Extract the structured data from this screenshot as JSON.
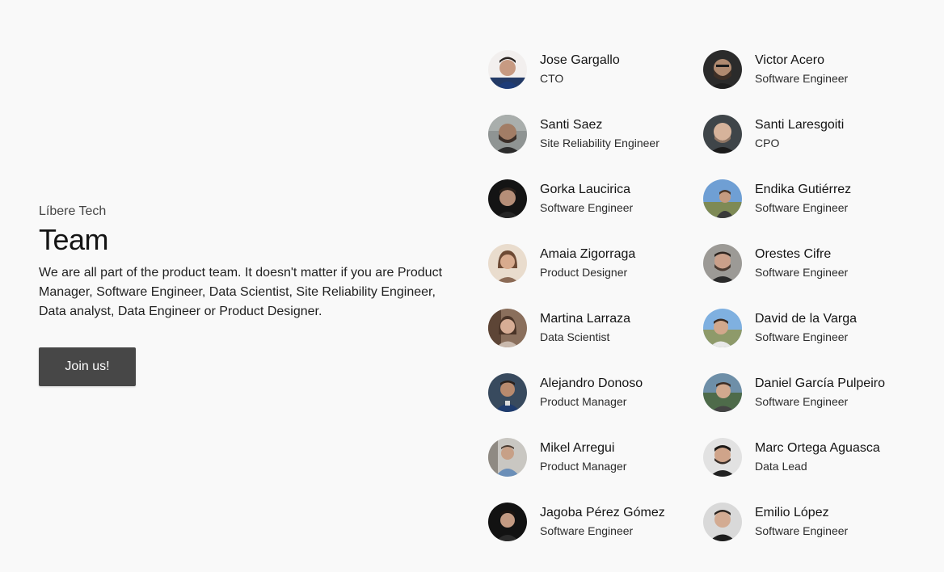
{
  "company": "Líbere Tech",
  "title": "Team",
  "description": "We are all part of the product team. It doesn't matter if you are Product Manager, Software Engineer, Data Scientist, Site Reliability Engineer, Data analyst, Data Engineer or Product Designer.",
  "join_button": "Join us!",
  "members": [
    {
      "name": "Jose Gargallo",
      "role": "CTO"
    },
    {
      "name": "Victor Acero",
      "role": "Software Engineer"
    },
    {
      "name": "Santi Saez",
      "role": "Site Reliability Engineer"
    },
    {
      "name": "Santi Laresgoiti",
      "role": "CPO"
    },
    {
      "name": "Gorka Laucirica",
      "role": "Software Engineer"
    },
    {
      "name": "Endika Gutiérrez",
      "role": "Software Engineer"
    },
    {
      "name": "Amaia Zigorraga",
      "role": "Product Designer"
    },
    {
      "name": "Orestes Cifre",
      "role": "Software Engineer"
    },
    {
      "name": "Martina Larraza",
      "role": "Data Scientist"
    },
    {
      "name": "David de la Varga",
      "role": "Software Engineer"
    },
    {
      "name": "Alejandro Donoso",
      "role": "Product Manager"
    },
    {
      "name": "Daniel García Pulpeiro",
      "role": "Software Engineer"
    },
    {
      "name": "Mikel Arregui",
      "role": "Product Manager"
    },
    {
      "name": "Marc Ortega Aguasca",
      "role": "Data Lead"
    },
    {
      "name": "Jagoba Pérez Gómez",
      "role": "Software Engineer"
    },
    {
      "name": "Emilio López",
      "role": "Software Engineer"
    }
  ]
}
